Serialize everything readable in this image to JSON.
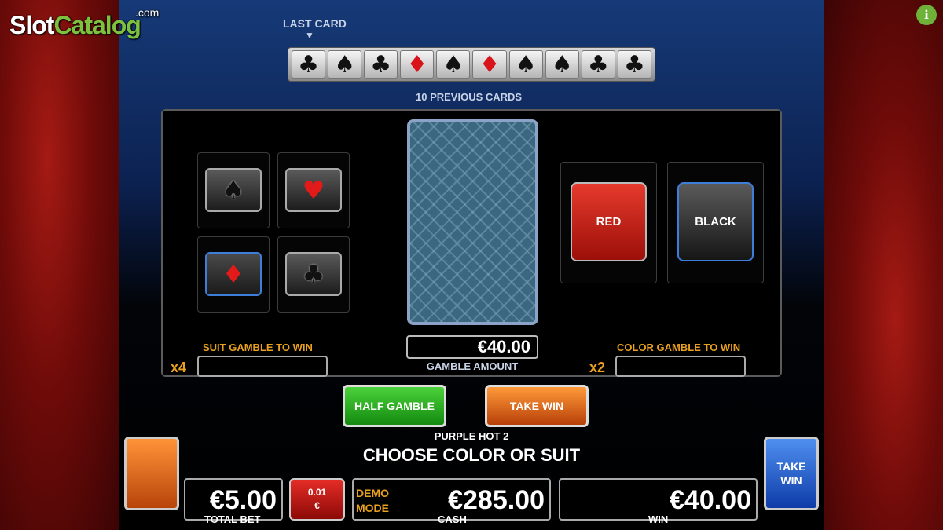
{
  "branding": {
    "logo_part1": "Slot",
    "logo_part2": "Catalog",
    "logo_suffix": ".com",
    "info": "i"
  },
  "history": {
    "last_card_label": "LAST CARD",
    "arrow": "▼",
    "previous_label": "10 PREVIOUS CARDS",
    "cards": [
      {
        "suit": "clubs",
        "symbol": "♣",
        "color": "black"
      },
      {
        "suit": "spades",
        "symbol": "♠",
        "color": "black"
      },
      {
        "suit": "clubs",
        "symbol": "♣",
        "color": "black"
      },
      {
        "suit": "diamonds",
        "symbol": "♦",
        "color": "red"
      },
      {
        "suit": "spades",
        "symbol": "♠",
        "color": "black"
      },
      {
        "suit": "diamonds",
        "symbol": "♦",
        "color": "red"
      },
      {
        "suit": "spades",
        "symbol": "♠",
        "color": "black"
      },
      {
        "suit": "spades",
        "symbol": "♠",
        "color": "black"
      },
      {
        "suit": "clubs",
        "symbol": "♣",
        "color": "black"
      },
      {
        "suit": "clubs",
        "symbol": "♣",
        "color": "black"
      }
    ]
  },
  "suits": {
    "spades": "♠",
    "hearts": "♥",
    "diamonds": "♦",
    "clubs": "♣"
  },
  "gamble": {
    "amount": "€40.00",
    "amount_label": "GAMBLE AMOUNT",
    "suit_label": "SUIT GAMBLE TO WIN",
    "suit_multiplier": "x4",
    "color_label": "COLOR GAMBLE TO WIN",
    "color_multiplier": "x2",
    "red_label": "RED",
    "black_label": "BLACK"
  },
  "actions": {
    "half_gamble": "HALF GAMBLE",
    "take_win": "TAKE WIN"
  },
  "game": {
    "name": "PURPLE HOT 2",
    "message": "CHOOSE COLOR OR SUIT"
  },
  "bottom": {
    "total_bet": "€5.00",
    "total_bet_label": "TOTAL BET",
    "coin_value": "0.01",
    "coin_currency": "€",
    "demo_line1": "DEMO",
    "demo_line2": "MODE",
    "cash": "€285.00",
    "cash_label": "CASH",
    "win": "€40.00",
    "win_label": "WIN",
    "take_win_side": "TAKE WIN"
  },
  "colors": {
    "accent_orange": "#e8a020",
    "selected_blue": "#3e7ed8",
    "red": "#d8141a"
  }
}
